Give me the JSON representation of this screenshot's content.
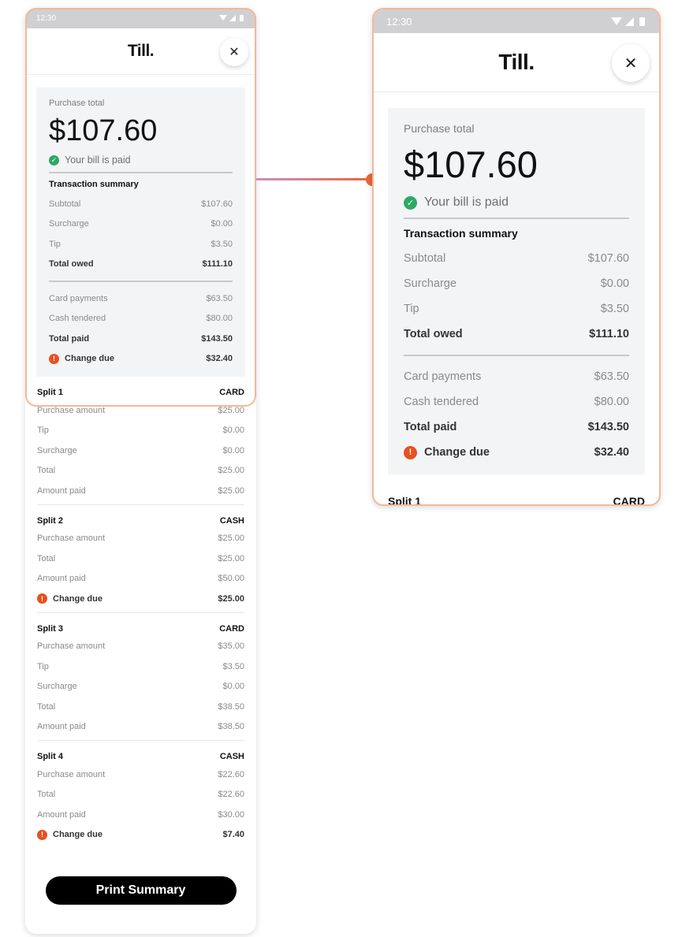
{
  "status_bar": {
    "time": "12:30"
  },
  "logo": "Till.",
  "close_glyph": "✕",
  "summary": {
    "purchase_total_label": "Purchase total",
    "purchase_total": "$107.60",
    "paid_status": "Your bill is paid",
    "section_title": "Transaction summary",
    "rows_a": [
      {
        "label": "Subtotal",
        "value": "$107.60"
      },
      {
        "label": "Surcharge",
        "value": "$0.00"
      },
      {
        "label": "Tip",
        "value": "$3.50"
      },
      {
        "label": "Total owed",
        "value": "$111.10",
        "bold": true
      }
    ],
    "rows_b": [
      {
        "label": "Card payments",
        "value": "$63.50"
      },
      {
        "label": "Cash tendered",
        "value": "$80.00"
      },
      {
        "label": "Total paid",
        "value": "$143.50",
        "bold": true
      },
      {
        "label": "Change due",
        "value": "$32.40",
        "bold": true,
        "alert": true
      }
    ]
  },
  "splits": [
    {
      "title": "Split 1",
      "method": "CARD",
      "rows": [
        {
          "label": "Purchase amount",
          "value": "$25.00"
        },
        {
          "label": "Tip",
          "value": "$0.00"
        },
        {
          "label": "Surcharge",
          "value": "$0.00"
        },
        {
          "label": "Total",
          "value": "$25.00"
        },
        {
          "label": "Amount paid",
          "value": "$25.00"
        }
      ]
    },
    {
      "title": "Split 2",
      "method": "CASH",
      "rows": [
        {
          "label": "Purchase amount",
          "value": "$25.00"
        },
        {
          "label": "Total",
          "value": "$25.00"
        },
        {
          "label": "Amount paid",
          "value": "$50.00"
        },
        {
          "label": "Change due",
          "value": "$25.00",
          "bold": true,
          "alert": true
        }
      ]
    },
    {
      "title": "Split 3",
      "method": "CARD",
      "rows": [
        {
          "label": "Purchase amount",
          "value": "$35.00"
        },
        {
          "label": "Tip",
          "value": "$3.50"
        },
        {
          "label": "Surcharge",
          "value": "$0.00"
        },
        {
          "label": "Total",
          "value": "$38.50"
        },
        {
          "label": "Amount paid",
          "value": "$38.50"
        }
      ]
    },
    {
      "title": "Split 4",
      "method": "CASH",
      "rows": [
        {
          "label": "Purchase amount",
          "value": "$22.60"
        },
        {
          "label": "Total",
          "value": "$22.60"
        },
        {
          "label": "Amount paid",
          "value": "$30.00"
        },
        {
          "label": "Change due",
          "value": "$7.40",
          "bold": true,
          "alert": true
        }
      ]
    }
  ],
  "print_button": "Print Summary",
  "colors": {
    "accent_orange": "#e8501f",
    "success_green": "#2ea865",
    "highlight_border": "#f4b89a"
  }
}
